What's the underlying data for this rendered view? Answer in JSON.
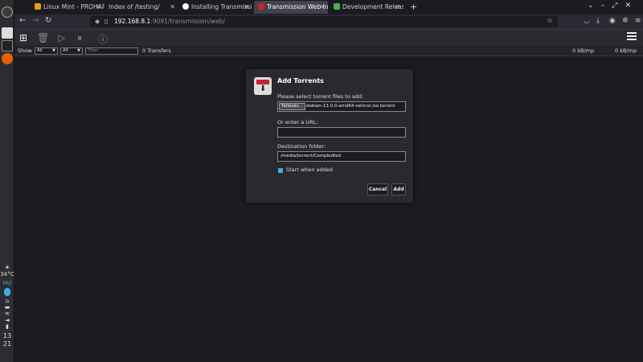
{
  "dock": {
    "temperature": "34°C",
    "keyboard_layout": "HU",
    "clock_hour": "13",
    "clock_minute": "21"
  },
  "tabs": [
    {
      "title": "Linux Mint - PROHARDVER",
      "active": false,
      "favicon_color": "#e5a00d"
    },
    {
      "title": "Index of /testing/",
      "active": false,
      "favicon_color": ""
    },
    {
      "title": "Installing Transmission",
      "active": false,
      "favicon_color": "#ffffff"
    },
    {
      "title": "Transmission Web Interface",
      "active": true,
      "favicon_color": "#c0262b"
    },
    {
      "title": "Development Releases",
      "active": false,
      "favicon_color": "#4caf50"
    }
  ],
  "url": {
    "host": "192.168.8.1",
    "rest": ":9091/transmission/web/"
  },
  "filterbar": {
    "show_label": "Show",
    "status_filter": "All",
    "tracker_filter": "All",
    "search_placeholder": "Filter",
    "transfer_count": "0 Transfers",
    "down_speed": "0 kB/mp",
    "up_speed": "0 kB/mp"
  },
  "dialog": {
    "title": "Add Torrents",
    "files_label": "Please select torrent files to add:",
    "browse_label": "Tallózás...",
    "file_name": "debian-13.0.0-amd64-netinst.iso.torrent",
    "url_label": "Or enter a URL:",
    "url_value": "",
    "dest_label": "Destination folder:",
    "dest_value": "/media/torrent/Compledted",
    "start_label": "Start when added",
    "start_checked": true,
    "cancel_label": "Cancel",
    "add_label": "Add"
  },
  "colors": {
    "accent": "#3daee9",
    "transmission_red": "#c0262b"
  }
}
